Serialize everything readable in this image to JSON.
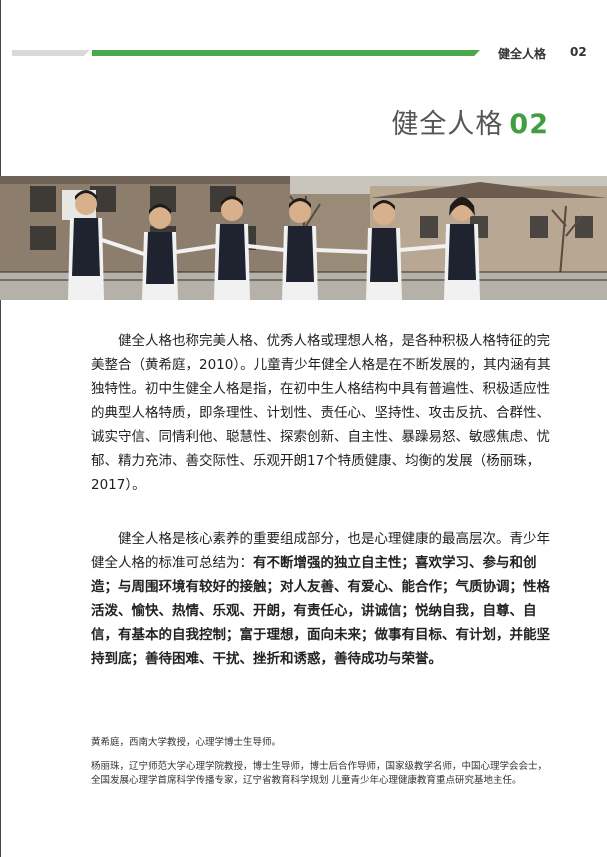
{
  "header": {
    "section_label": "健全人格",
    "page_number": "02",
    "bar_colors": {
      "gray": "#d9d9d9",
      "green": "#4aa84a"
    }
  },
  "title": {
    "text": "健全人格",
    "number": "02",
    "number_color": "#3f9f3f"
  },
  "photo": {
    "alt_icon": "students-running-photo"
  },
  "paragraph1": "健全人格也称完美人格、优秀人格或理想人格，是各种积极人格特征的完美整合（黄希庭，2010）。儿童青少年健全人格是在不断发展的，其内涵有其独特性。初中生健全人格是指，在初中生人格结构中具有普遍性、积极适应性的典型人格特质，即条理性、计划性、责任心、坚持性、攻击反抗、合群性、诚实守信、同情利他、聪慧性、探索创新、自主性、暴躁易怒、敏感焦虑、忧郁、精力充沛、善交际性、乐观开朗17个特质健康、均衡的发展（杨丽珠，2017）。",
  "paragraph2": {
    "intro": "健全人格是核心素养的重要组成部分，也是心理健康的最高层次。青少年健全人格的标准可总结为：",
    "bold": "有不断增强的独立自主性；喜欢学习、参与和创造；与周围环境有较好的接触；对人友善、有爱心、能合作；气质协调；性格活泼、愉快、热情、乐观、开朗，有责任心，讲诚信；悦纳自我，自尊、自信，有基本的自我控制；富于理想，面向未来；做事有目标、有计划，并能坚持到底；善待困难、干扰、挫折和诱惑，善待成功与荣誉。"
  },
  "notes": {
    "note1": "黄希庭，西南大学教授，心理学博士生导师。",
    "note2": "杨丽珠，辽宁师范大学心理学院教授，博士生导师，博士后合作导师，国家级教学名师，中国心理学会会士，全国发展心理学首席科学传播专家，辽宁省教育科学规划 儿童青少年心理健康教育重点研究基地主任。"
  }
}
